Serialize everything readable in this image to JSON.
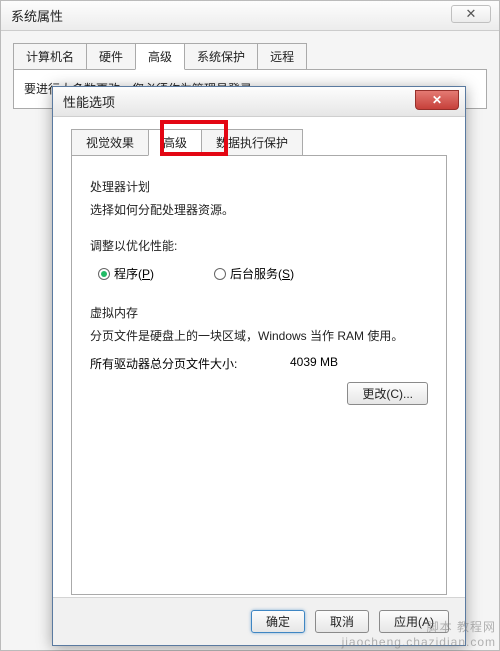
{
  "parent": {
    "title": "系统属性",
    "tabs": [
      "计算机名",
      "硬件",
      "高级",
      "系统保护",
      "远程"
    ],
    "active_tab_index": 2,
    "truncated_text": "要进行大多数更改，您必须作为管理员登录。"
  },
  "child": {
    "title": "性能选项",
    "tabs": [
      "视觉效果",
      "高级",
      "数据执行保护"
    ],
    "active_tab_index": 1,
    "processor": {
      "heading": "处理器计划",
      "desc": "选择如何分配处理器资源。",
      "adjust_label": "调整以优化性能:",
      "options": {
        "programs": {
          "label": "程序",
          "hotkey": "P",
          "checked": true
        },
        "services": {
          "label": "后台服务",
          "hotkey": "S",
          "checked": false
        }
      }
    },
    "vm": {
      "heading": "虚拟内存",
      "desc": "分页文件是硬盘上的一块区域，Windows 当作 RAM 使用。",
      "total_label": "所有驱动器总分页文件大小:",
      "total_value": "4039 MB",
      "change_btn": "更改(C)..."
    },
    "buttons": {
      "ok": "确定",
      "cancel": "取消",
      "apply": "应用(A)"
    }
  },
  "watermark": {
    "line1": "脚本 教程网",
    "line2": "jiaocheng.chazidian.com"
  }
}
